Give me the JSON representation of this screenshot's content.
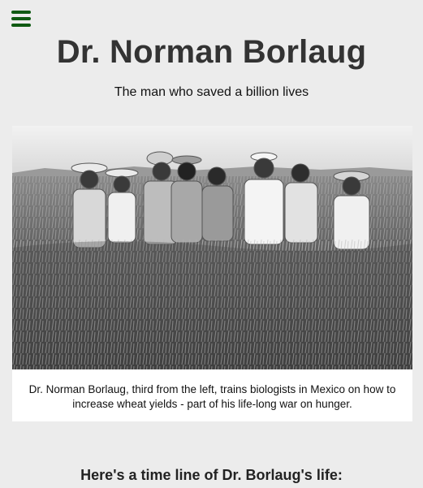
{
  "header": {
    "title": "Dr. Norman Borlaug",
    "subtitle": "The man who saved a billion lives",
    "menu_icon": "hamburger-menu-icon"
  },
  "photo": {
    "caption": "Dr. Norman Borlaug, third from the left, trains biologists in Mexico on how to increase wheat yields - part of his life-long war on hunger."
  },
  "timeline": {
    "heading": "Here's a time line of Dr. Borlaug's life:"
  },
  "colors": {
    "background": "#ececec",
    "menu_icon": "#0f5a12",
    "card": "#ffffff"
  }
}
